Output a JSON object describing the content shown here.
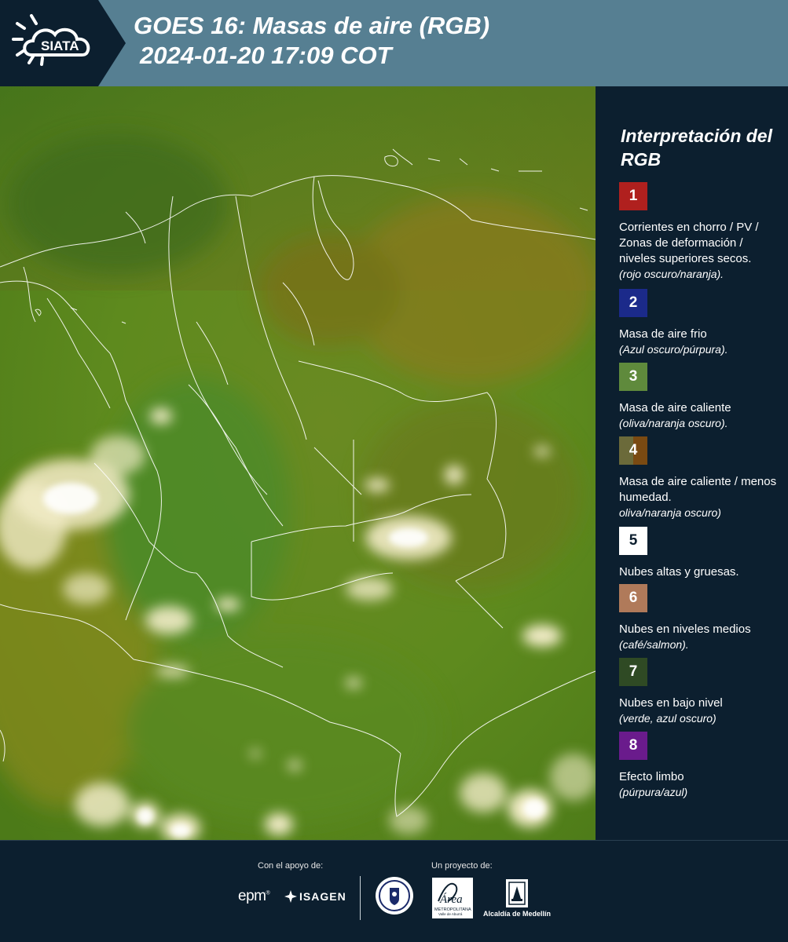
{
  "header": {
    "brand": "SIATA",
    "title_line1": "GOES 16: Masas de aire (RGB)",
    "title_line2": "2024-01-20 17:09 COT"
  },
  "legend": {
    "title": "Interpretación del RGB",
    "items": [
      {
        "number": "1",
        "color": "#b0201e",
        "text": "Corrientes en chorro / PV / Zonas de deformación / niveles superiores secos.",
        "note": "(rojo oscuro/naranja)."
      },
      {
        "number": "2",
        "color": "#1b2a8a",
        "text": "Masa de aire frio",
        "note": "(Azul oscuro/púrpura)."
      },
      {
        "number": "3",
        "color": "#5f8a3c",
        "text": "Masa de aire caliente",
        "note": "(oliva/naranja oscuro)."
      },
      {
        "number": "4",
        "color": "#6b5e2a",
        "text": "Masa de aire caliente / menos humedad.",
        "note": "oliva/naranja oscuro)"
      },
      {
        "number": "5",
        "color": "#ffffff",
        "text": "Nubes altas y gruesas.",
        "note": ""
      },
      {
        "number": "6",
        "color": "#b07a5a",
        "text": "Nubes en niveles medios",
        "note": "(café/salmon)."
      },
      {
        "number": "7",
        "color": "#2f4a24",
        "text": "Nubes en bajo nivel",
        "note": "(verde, azul oscuro)"
      },
      {
        "number": "8",
        "color": "#6a1b8c",
        "text": "Efecto limbo",
        "note": "(púrpura/azul)"
      }
    ]
  },
  "footer": {
    "support_label": "Con el apoyo de:",
    "project_label": "Un proyecto de:",
    "epm": "epm",
    "isagen": "ISAGEN",
    "area_line1": "Área",
    "area_line2": "METROPOLITANA",
    "area_line3": "Valle de Aburrá",
    "alcaldia": "Alcaldía de Medellín"
  }
}
